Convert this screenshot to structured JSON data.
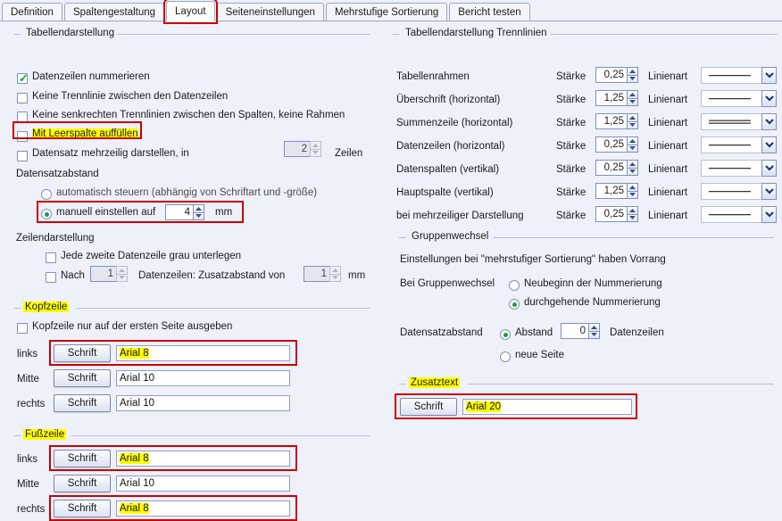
{
  "tabs": [
    {
      "label": "Definition",
      "active": false,
      "highlight": false
    },
    {
      "label": "Spaltengestaltung",
      "active": false,
      "highlight": false
    },
    {
      "label": "Layout",
      "active": true,
      "highlight": true
    },
    {
      "label": "Seiteneinstellungen",
      "active": false,
      "highlight": false
    },
    {
      "label": "Mehrstufige Sortierung",
      "active": false,
      "highlight": false
    },
    {
      "label": "Bericht testen",
      "active": false,
      "highlight": false
    }
  ],
  "left": {
    "table_display": {
      "title": "Tabellendarstellung",
      "checkboxes": [
        {
          "label": "Datenzeilen nummerieren",
          "checked": true,
          "highlight": false
        },
        {
          "label": "Keine Trennlinie zwischen den Datenzeilen",
          "checked": false,
          "highlight": false
        },
        {
          "label": "Keine senkrechten Trennlinien zwischen den Spalten, keine Rahmen",
          "checked": false,
          "highlight": false
        },
        {
          "label": "Mit Leerspalte auffüllen",
          "checked": false,
          "highlight": true
        },
        {
          "label": "Datensatz mehrzeilig darstellen, in",
          "checked": false,
          "highlight": false
        }
      ],
      "multiline_rows_value": "2",
      "multiline_rows_unit": "Zeilen"
    },
    "record_spacing": {
      "title": "Datensatzabstand",
      "option_auto": "automatisch steuern (abhängig von Schriftart und -größe)",
      "option_manual": "manuell einstellen auf",
      "selected": "manual",
      "manual_value": "4",
      "manual_unit": "mm"
    },
    "row_display": {
      "title": "Zeilendarstellung",
      "shade_label": "Jede zweite Datenzeile grau unterlegen",
      "shade_checked": false,
      "after_label": "Nach",
      "after_value": "1",
      "after_checked": false,
      "extra_label": "Datenzeilen: Zusatzabstand von",
      "extra_value": "1",
      "extra_unit": "mm"
    },
    "header": {
      "title": "Kopfzeile",
      "first_page_only": "Kopfzeile nur auf der ersten Seite ausgeben",
      "first_page_only_checked": false,
      "font_button": "Schrift",
      "rows": [
        {
          "position": "links",
          "value": "Arial 8",
          "highlight": true
        },
        {
          "position": "Mitte",
          "value": "Arial 10",
          "highlight": false
        },
        {
          "position": "rechts",
          "value": "Arial 10",
          "highlight": false
        }
      ]
    },
    "footer": {
      "title": "Fußzeile",
      "font_button": "Schrift",
      "rows": [
        {
          "position": "links",
          "value": "Arial 8",
          "highlight": true
        },
        {
          "position": "Mitte",
          "value": "Arial 10",
          "highlight": false
        },
        {
          "position": "rechts",
          "value": "Arial 8",
          "highlight": true
        }
      ]
    }
  },
  "right": {
    "separators": {
      "title": "Tabellendarstellung Trennlinien",
      "strength_label": "Stärke",
      "linestyle_label": "Linienart",
      "rows": [
        {
          "name": "Tabellenrahmen",
          "strength": "0,25",
          "style": "single"
        },
        {
          "name": "Überschrift (horizontal)",
          "strength": "1,25",
          "style": "single"
        },
        {
          "name": "Summenzeile (horizontal)",
          "strength": "1,25",
          "style": "double"
        },
        {
          "name": "Datenzeilen (horizontal)",
          "strength": "0,25",
          "style": "single"
        },
        {
          "name": "Datenspalten (vertikal)",
          "strength": "0,25",
          "style": "single"
        },
        {
          "name": "Hauptspalte (vertikal)",
          "strength": "1,25",
          "style": "single"
        },
        {
          "name": "bei mehrzeiliger Darstellung",
          "strength": "0,25",
          "style": "single"
        }
      ]
    },
    "group_change": {
      "title": "Gruppenwechsel",
      "note": "Einstellungen bei \"mehrstufiger Sortierung\" haben Vorrang",
      "label": "Bei Gruppenwechsel",
      "option_restart": "Neubeginn der Nummerierung",
      "option_continuous": "durchgehende Nummerierung",
      "numbering_selected": "continuous",
      "spacing_label": "Datensatzabstand",
      "option_distance": "Abstand",
      "distance_value": "0",
      "distance_unit": "Datenzeilen",
      "option_newpage": "neue Seite",
      "spacing_selected": "distance"
    },
    "extra_text": {
      "title": "Zusatztext",
      "font_button": "Schrift",
      "value": "Arial 20",
      "highlight": true
    }
  },
  "colors": {
    "background": "#eef0fa",
    "highlight": "#ffff00",
    "annotation": "#cc0000",
    "check": "#1f9d3c"
  }
}
